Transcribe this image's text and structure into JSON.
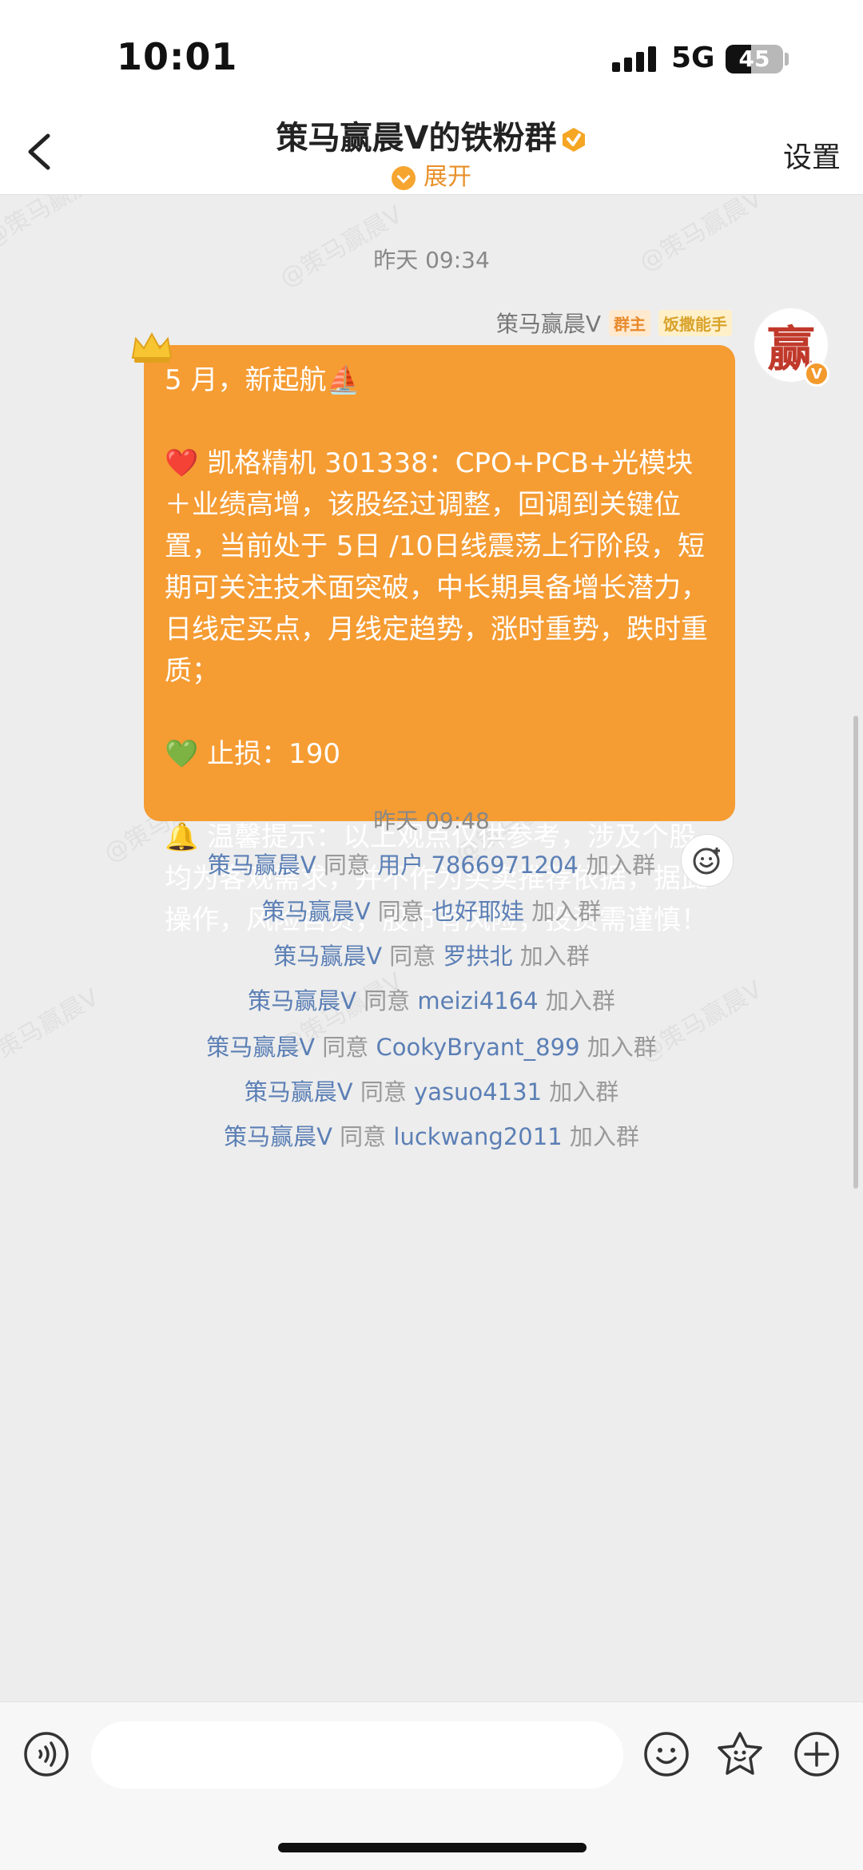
{
  "status_bar": {
    "time": "10:01",
    "network": "5G",
    "battery": "45"
  },
  "nav": {
    "title": "策马赢晨Ⅴ的铁粉群",
    "expand_label": "展开",
    "settings_label": "设置"
  },
  "watermark_text": "@策马赢晨V",
  "messages": {
    "timestamp_1": "昨天 09:34",
    "sender_name": "策马赢晨Ⅴ",
    "tag_owner": "群主",
    "tag_fan": "饭撒能手",
    "avatar_char": "赢",
    "bubble_lines": [
      "5 月，新起航⛵",
      "",
      "❤️ 凯格精机 301338：CPO+PCB+光模块＋业绩高增，该股经过调整，回调到关键位置，当前处于 5日 /10日线震荡上行阶段，短期可关注技术面突破，中长期具备增长潜力，日线定买点，月线定趋势，涨时重势，跌时重质；",
      "",
      "💚 止损：190",
      "",
      "🔔 温馨提示：以上观点仅供参考，涉及个股均为客观需求，并不作为买卖推荐依据，据此操作，风险自负，股市有风险，投资需谨慎！"
    ],
    "timestamp_2": "昨天 09:48",
    "system": [
      {
        "actor": "策马赢晨Ⅴ",
        "verb": "同意",
        "user": "用户 7866971204",
        "suffix": "加入群"
      },
      {
        "actor": "策马赢晨Ⅴ",
        "verb": "同意",
        "user": "也好耶娃",
        "suffix": "加入群"
      },
      {
        "actor": "策马赢晨Ⅴ",
        "verb": "同意",
        "user": "罗拱北",
        "suffix": "加入群"
      },
      {
        "actor": "策马赢晨Ⅴ",
        "verb": "同意",
        "user": "meizi4164",
        "suffix": "加入群"
      },
      {
        "actor": "策马赢晨Ⅴ",
        "verb": "同意",
        "user": "CookyBryant_899",
        "suffix": "加入群"
      },
      {
        "actor": "策马赢晨Ⅴ",
        "verb": "同意",
        "user": "yasuo4131",
        "suffix": "加入群"
      },
      {
        "actor": "策马赢晨Ⅴ",
        "verb": "同意",
        "user": "luckwang2011",
        "suffix": "加入群"
      }
    ]
  },
  "icons": {
    "back": "chevron-left-icon",
    "voice": "voice-icon",
    "emoji": "emoji-icon",
    "sticker": "sticker-icon",
    "plus": "plus-icon",
    "react": "add-reaction-icon"
  },
  "colors": {
    "bubble": "#f59c33",
    "link": "#5b7fb5",
    "accent": "#e9902a"
  }
}
